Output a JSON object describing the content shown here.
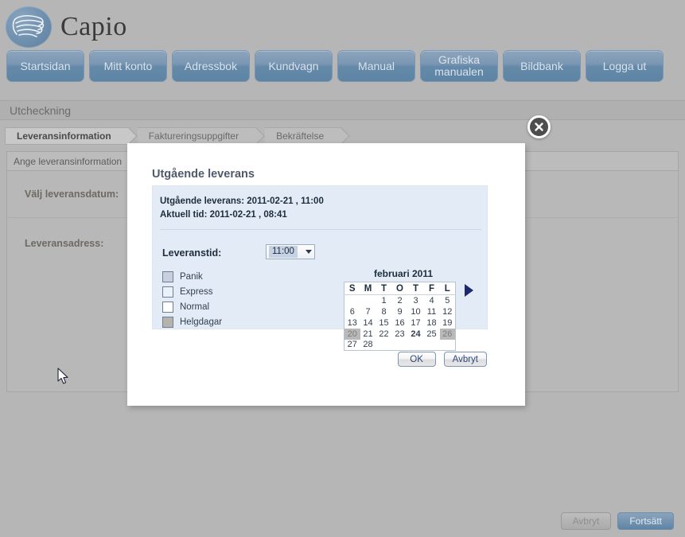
{
  "brand": {
    "name": "Capio",
    "logo_icon": "capio-scribble-icon"
  },
  "nav": {
    "items": [
      {
        "label": "Startsidan"
      },
      {
        "label": "Mitt konto"
      },
      {
        "label": "Adressbok"
      },
      {
        "label": "Kundvagn"
      },
      {
        "label": "Manual"
      },
      {
        "label": "Grafiska manualen",
        "line1": "Grafiska",
        "line2": "manualen"
      },
      {
        "label": "Bildbank"
      },
      {
        "label": "Logga ut"
      }
    ]
  },
  "page": {
    "title": "Utcheckning"
  },
  "steps": [
    {
      "label": "Leveransinformation",
      "active": true
    },
    {
      "label": "Faktureringsuppgifter",
      "active": false
    },
    {
      "label": "Bekräftelse",
      "active": false
    }
  ],
  "panel": {
    "header": "Ange leveransinformation",
    "rows": [
      {
        "label": "Välj leveransdatum:"
      },
      {
        "label": "Leveransadress:"
      }
    ]
  },
  "footer": {
    "cancel_label": "Avbryt",
    "continue_label": "Fortsätt"
  },
  "dialog": {
    "close_icon": "close-circle-icon",
    "title": "Utgående leverans",
    "info_line_1": "Utgående leverans: 2011-02-21 , 11:00",
    "info_line_2": "Aktuell tid: 2011-02-21 , 08:41",
    "time_label": "Leveranstid:",
    "time_value": "11:00",
    "time_caret_icon": "chevron-down-icon",
    "legend": [
      {
        "label": "Panik",
        "color": "#c8d0e0"
      },
      {
        "label": "Express",
        "color": "#eaf1fa"
      },
      {
        "label": "Normal",
        "color": "#ffffff"
      },
      {
        "label": "Helgdagar",
        "color": "#b6b3ad"
      }
    ],
    "ok_label": "OK",
    "cancel_label": "Avbryt"
  },
  "calendar": {
    "month_title": "februari 2011",
    "next_icon": "arrow-right-icon",
    "weekday_headers": [
      "S",
      "M",
      "T",
      "O",
      "T",
      "F",
      "L"
    ],
    "weeks": [
      [
        {
          "day": "",
          "state": "pad"
        },
        {
          "day": "",
          "state": "pad"
        },
        {
          "day": "1",
          "state": "normal"
        },
        {
          "day": "2",
          "state": "normal"
        },
        {
          "day": "3",
          "state": "normal"
        },
        {
          "day": "4",
          "state": "normal"
        },
        {
          "day": "5",
          "state": "weekend"
        }
      ],
      [
        {
          "day": "6",
          "state": "weekend"
        },
        {
          "day": "7",
          "state": "normal"
        },
        {
          "day": "8",
          "state": "normal"
        },
        {
          "day": "9",
          "state": "normal"
        },
        {
          "day": "10",
          "state": "normal"
        },
        {
          "day": "11",
          "state": "normal"
        },
        {
          "day": "12",
          "state": "weekend"
        }
      ],
      [
        {
          "day": "13",
          "state": "weekend"
        },
        {
          "day": "14",
          "state": "normal"
        },
        {
          "day": "15",
          "state": "normal"
        },
        {
          "day": "16",
          "state": "normal"
        },
        {
          "day": "17",
          "state": "normal"
        },
        {
          "day": "18",
          "state": "normal"
        },
        {
          "day": "19",
          "state": "weekend"
        }
      ],
      [
        {
          "day": "20",
          "state": "selweek weekend"
        },
        {
          "day": "21",
          "state": "selweek"
        },
        {
          "day": "22",
          "state": "selweek"
        },
        {
          "day": "23",
          "state": "selweek"
        },
        {
          "day": "24",
          "state": "today"
        },
        {
          "day": "25",
          "state": "selweek"
        },
        {
          "day": "26",
          "state": "selweek weekend"
        }
      ],
      [
        {
          "day": "27",
          "state": "weekend"
        },
        {
          "day": "28",
          "state": "normal"
        },
        {
          "day": "",
          "state": "pad"
        },
        {
          "day": "",
          "state": "pad"
        },
        {
          "day": "",
          "state": "pad"
        },
        {
          "day": "",
          "state": "pad"
        },
        {
          "day": "",
          "state": "pad"
        }
      ]
    ]
  }
}
